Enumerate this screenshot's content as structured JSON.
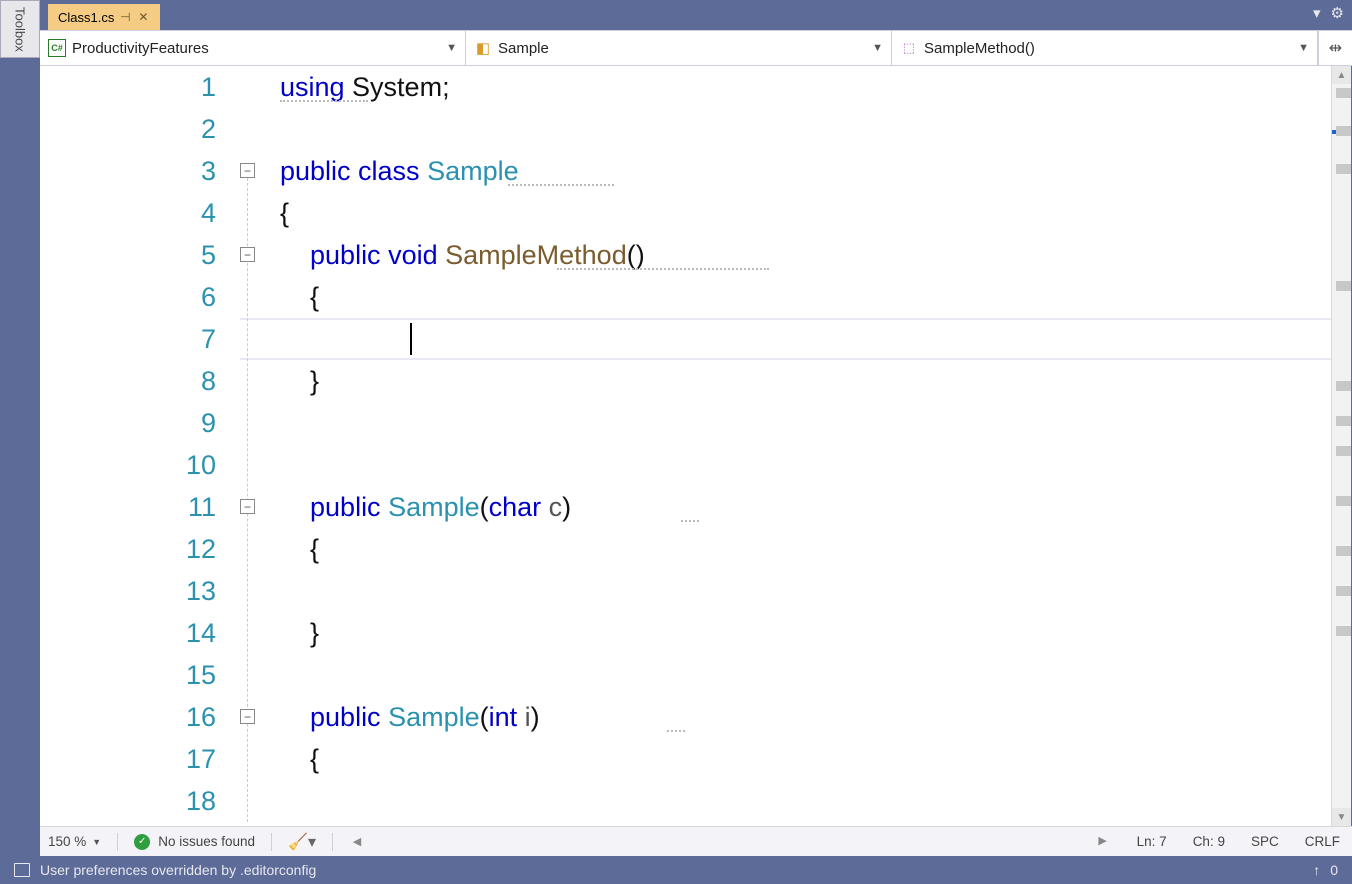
{
  "toolbox_label": "Toolbox",
  "tab": {
    "filename": "Class1.cs"
  },
  "nav": {
    "namespace": "ProductivityFeatures",
    "class": "Sample",
    "member": "SampleMethod()"
  },
  "lines": [
    "1",
    "2",
    "3",
    "4",
    "5",
    "6",
    "7",
    "8",
    "9",
    "10",
    "11",
    "12",
    "13",
    "14",
    "15",
    "16",
    "17",
    "18"
  ],
  "code": {
    "l1_kw": "using",
    "l1_rest": " System;",
    "l3_kw": "public class ",
    "l3_type": "Sample",
    "l4": "{",
    "l5_indent": "    ",
    "l5_kw": "public void ",
    "l5_ident": "SampleMethod",
    "l5_rest": "()",
    "l6": "    {",
    "l8": "    }",
    "l11_indent": "    ",
    "l11_kw1": "public ",
    "l11_type": "Sample",
    "l11_mid": "(",
    "l11_kw2": "char",
    "l11_sp": " ",
    "l11_param": "c",
    "l11_end": ")",
    "l12": "    {",
    "l14": "    }",
    "l16_indent": "    ",
    "l16_kw1": "public ",
    "l16_type": "Sample",
    "l16_mid": "(",
    "l16_kw2": "int",
    "l16_sp": " ",
    "l16_param": "i",
    "l16_end": ")",
    "l17": "    {"
  },
  "status": {
    "zoom": "150 %",
    "issues": "No issues found",
    "ln": "Ln: 7",
    "ch": "Ch: 9",
    "indent": "SPC",
    "eol": "CRLF"
  },
  "bottom_message": "User preferences overridden by .editorconfig",
  "bottom_right": {
    "arrow": "↑",
    "count": "0"
  }
}
